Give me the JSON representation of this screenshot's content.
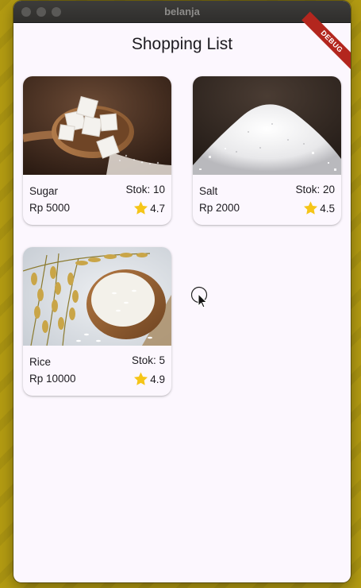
{
  "window": {
    "title": "belanja"
  },
  "app": {
    "title": "Shopping List",
    "debug_banner": "DEBUG"
  },
  "products": [
    {
      "name": "Sugar",
      "stock": "Stok: 10",
      "price": "Rp 5000",
      "rating": "4.7",
      "image": "sugar-cubes-on-wooden-spoon"
    },
    {
      "name": "Salt",
      "stock": "Stok: 20",
      "price": "Rp 2000",
      "rating": "4.5",
      "image": "pile-of-salt"
    },
    {
      "name": "Rice",
      "stock": "Stok: 5",
      "price": "Rp 10000",
      "rating": "4.9",
      "image": "rice-bowl-and-stalks"
    }
  ],
  "colors": {
    "star": "#f5c518",
    "window_bg": "#fcf7fe",
    "titlebar": "#3a3937",
    "desktop": "#b39b12"
  }
}
